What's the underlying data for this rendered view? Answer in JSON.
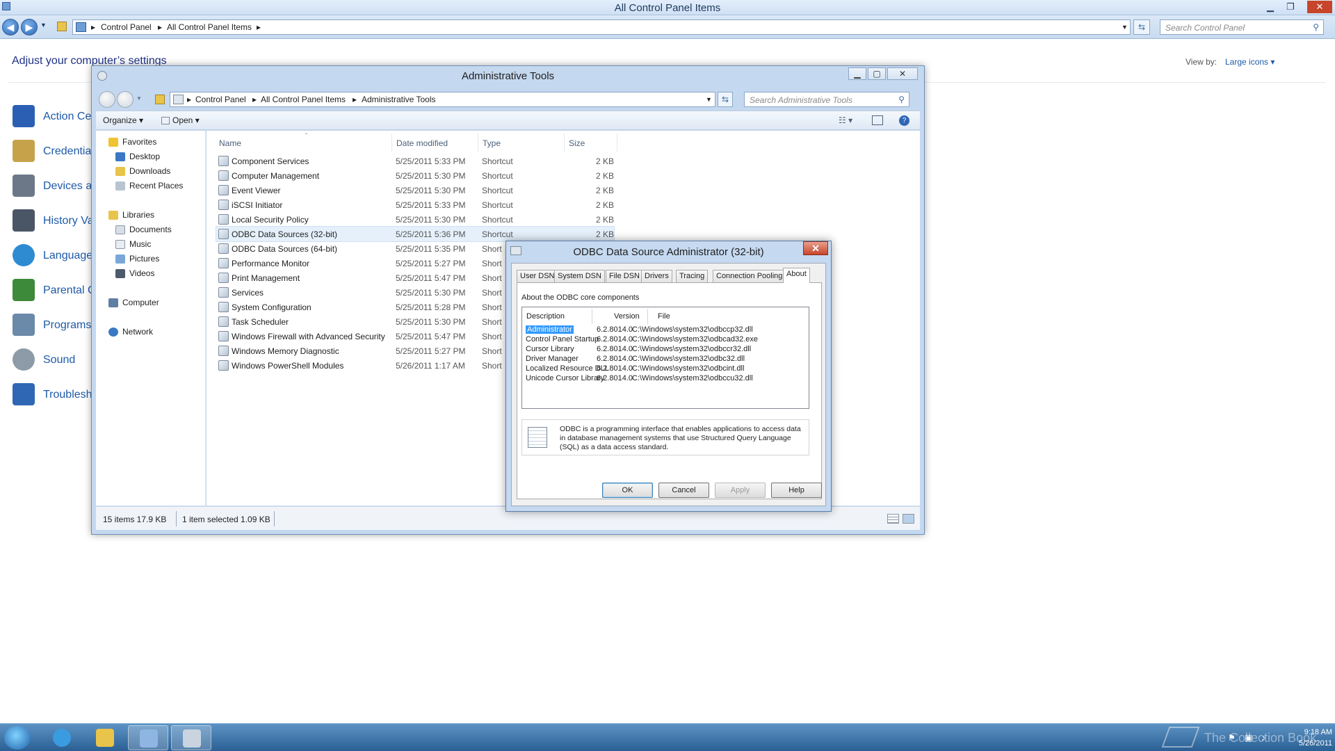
{
  "control_panel": {
    "title": "All Control Panel Items",
    "breadcrumb": [
      "Control Panel",
      "All Control Panel Items"
    ],
    "search_placeholder": "Search Control Panel",
    "heading": "Adjust your computer’s settings",
    "view_by_label": "View by:",
    "view_by_value": "Large icons",
    "items": [
      {
        "label": "Action Ce",
        "icon": "flag-icon",
        "color": "#2b5fb3"
      },
      {
        "label": "Credentia",
        "icon": "vault-icon",
        "color": "#c6a24a"
      },
      {
        "label": "Devices ar",
        "icon": "printer-icon",
        "color": "#6c7888"
      },
      {
        "label": "History Va",
        "icon": "history-icon",
        "color": "#4a5566"
      },
      {
        "label": "Language",
        "icon": "globe-icon",
        "color": "#2e8bd2"
      },
      {
        "label": "Parental C",
        "icon": "people-icon",
        "color": "#3d8a3a"
      },
      {
        "label": "Programs",
        "icon": "programs-icon",
        "color": "#6b89a9"
      },
      {
        "label": "Sound",
        "icon": "speaker-icon",
        "color": "#8d9aa8"
      },
      {
        "label": "Troublesh",
        "icon": "monitor-icon",
        "color": "#2f67b5"
      }
    ]
  },
  "admin_tools": {
    "title": "Administrative Tools",
    "breadcrumb": [
      "Control Panel",
      "All Control Panel Items",
      "Administrative Tools"
    ],
    "search_placeholder": "Search Administrative Tools",
    "toolbar": {
      "organize": "Organize ▾",
      "open": "Open ▾"
    },
    "nav": {
      "favorites": "Favorites",
      "favorites_items": [
        "Desktop",
        "Downloads",
        "Recent Places"
      ],
      "libraries": "Libraries",
      "libraries_items": [
        "Documents",
        "Music",
        "Pictures",
        "Videos"
      ],
      "computer": "Computer",
      "network": "Network"
    },
    "columns": [
      "Name",
      "Date modified",
      "Type",
      "Size"
    ],
    "files": [
      {
        "name": "Component Services",
        "date": "5/25/2011 5:33 PM",
        "type": "Shortcut",
        "size": "2 KB"
      },
      {
        "name": "Computer Management",
        "date": "5/25/2011 5:30 PM",
        "type": "Shortcut",
        "size": "2 KB"
      },
      {
        "name": "Event Viewer",
        "date": "5/25/2011 5:30 PM",
        "type": "Shortcut",
        "size": "2 KB"
      },
      {
        "name": "iSCSI Initiator",
        "date": "5/25/2011 5:33 PM",
        "type": "Shortcut",
        "size": "2 KB"
      },
      {
        "name": "Local Security Policy",
        "date": "5/25/2011 5:30 PM",
        "type": "Shortcut",
        "size": "2 KB"
      },
      {
        "name": "ODBC Data Sources (32-bit)",
        "date": "5/25/2011 5:36 PM",
        "type": "Shortcut",
        "size": "2 KB",
        "selected": true
      },
      {
        "name": "ODBC Data Sources (64-bit)",
        "date": "5/25/2011 5:35 PM",
        "type": "Short",
        "size": ""
      },
      {
        "name": "Performance Monitor",
        "date": "5/25/2011 5:27 PM",
        "type": "Short",
        "size": ""
      },
      {
        "name": "Print Management",
        "date": "5/25/2011 5:47 PM",
        "type": "Short",
        "size": ""
      },
      {
        "name": "Services",
        "date": "5/25/2011 5:30 PM",
        "type": "Short",
        "size": ""
      },
      {
        "name": "System Configuration",
        "date": "5/25/2011 5:28 PM",
        "type": "Short",
        "size": ""
      },
      {
        "name": "Task Scheduler",
        "date": "5/25/2011 5:30 PM",
        "type": "Short",
        "size": ""
      },
      {
        "name": "Windows Firewall with Advanced Security",
        "date": "5/25/2011 5:47 PM",
        "type": "Short",
        "size": ""
      },
      {
        "name": "Windows Memory Diagnostic",
        "date": "5/25/2011 5:27 PM",
        "type": "Short",
        "size": ""
      },
      {
        "name": "Windows PowerShell Modules",
        "date": "5/26/2011 1:17 AM",
        "type": "Short",
        "size": ""
      }
    ],
    "status": {
      "items": "15 items 17.9 KB",
      "selected": "1 item selected 1.09 KB"
    }
  },
  "odbc_dialog": {
    "title": "ODBC Data Source Administrator (32-bit)",
    "tabs": [
      "User DSN",
      "System DSN",
      "File DSN",
      "Drivers",
      "Tracing",
      "Connection Pooling",
      "About"
    ],
    "active_tab": "About",
    "about_label": "About the ODBC core components",
    "table_headers": [
      "Description",
      "Version",
      "File"
    ],
    "components": [
      {
        "description": "Administrator",
        "version": "6.2.8014.0",
        "file": "C:\\Windows\\system32\\odbccp32.dll",
        "selected": true
      },
      {
        "description": "Control Panel Startup",
        "version": "6.2.8014.0",
        "file": "C:\\Windows\\system32\\odbcad32.exe"
      },
      {
        "description": "Cursor Library",
        "version": "6.2.8014.0",
        "file": "C:\\Windows\\system32\\odbccr32.dll"
      },
      {
        "description": "Driver Manager",
        "version": "6.2.8014.0",
        "file": "C:\\Windows\\system32\\odbc32.dll"
      },
      {
        "description": "Localized Resource DLL",
        "version": "6.2.8014.0",
        "file": "C:\\Windows\\system32\\odbcint.dll"
      },
      {
        "description": "Unicode Cursor Library",
        "version": "6.2.8014.0",
        "file": "C:\\Windows\\system32\\odbccu32.dll"
      }
    ],
    "info_text": "ODBC is a programming interface that enables applications to access data in database management systems that use Structured Query Language (SQL) as a data access standard.",
    "buttons": {
      "ok": "OK",
      "cancel": "Cancel",
      "apply": "Apply",
      "help": "Help"
    }
  },
  "taskbar": {
    "time": "9:18 AM",
    "date": "5/26/2011",
    "watermark": "The Collection Book",
    "apps": [
      "internet-explorer-icon",
      "explorer-folder-icon",
      "control-panel-icon",
      "odbc-admin-icon"
    ]
  }
}
